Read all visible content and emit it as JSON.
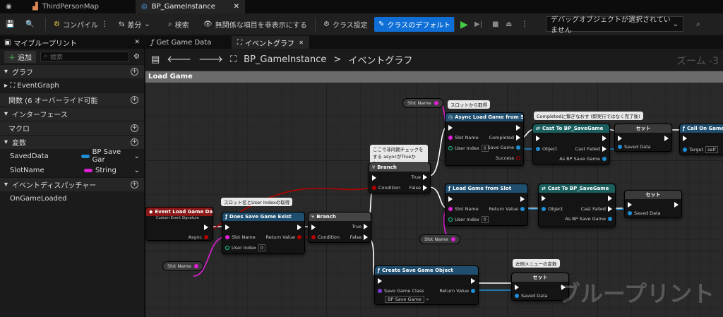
{
  "tabs": {
    "items": [
      {
        "label": "ThirdPersonMap"
      },
      {
        "label": "BP_GameInstance"
      }
    ]
  },
  "toolbar": {
    "compile": "コンパイル",
    "diff": "差分",
    "search": "検索",
    "hide": "無関係な項目を非表示にする",
    "class_settings": "クラス設定",
    "class_defaults": "クラスのデフォルト",
    "debug": "デバッグオブジェクトが選択されていません"
  },
  "left": {
    "title": "マイブループリント",
    "add": "追加",
    "search_placeholder": "検索",
    "graph": "グラフ",
    "eventgraph": "EventGraph",
    "functions": "関数 (6 オーバーライド可能",
    "interfaces": "インターフェース",
    "macros": "マクロ",
    "variables": "変数",
    "vars": [
      {
        "name": "SavedData",
        "type": "BP Save Gar",
        "color": "#1e8fd6"
      },
      {
        "name": "SlotName",
        "type": "String",
        "color": "#e01fd6"
      }
    ],
    "dispatchers": "イベントディスパッチャー",
    "dispatcher_item": "OnGameLoaded"
  },
  "graph": {
    "tab1": "Get Game Data",
    "tab2": "イベントグラフ",
    "crumb1": "BP_GameInstance",
    "crumb_sep": ">",
    "crumb2": "イベントグラフ",
    "zoom": "ズーム -3",
    "comment": "Load Game",
    "watermark": "ブループリント",
    "nodes": {
      "event": {
        "title": "Event Load Game Data",
        "sub": "Custom Event Signature",
        "async": "Async"
      },
      "exists": {
        "title": "Does Save Game Exist",
        "slot": "Slot Name",
        "ret": "Return Value",
        "user": "User Index",
        "user_val": "0"
      },
      "branch1": {
        "title": "Branch",
        "cond": "Condition",
        "t": "True",
        "f": "False"
      },
      "branch2": {
        "title": "Branch",
        "cond": "Condition",
        "t": "True",
        "f": "False"
      },
      "async_load": {
        "title": "Async Load Game from Slot",
        "slot": "Slot Name",
        "user": "User Index",
        "user_val": "0",
        "completed": "Completed",
        "save": "Save Game",
        "success": "Success"
      },
      "cast1": {
        "title": "Cast To BP_SaveGame",
        "obj": "Object",
        "failed": "Cast Failed",
        "as": "As BP Save Game"
      },
      "set1": {
        "title": "セット",
        "saved": "Saved Data"
      },
      "call": {
        "title": "Call On Game Lo",
        "target": "Target",
        "self": "self"
      },
      "load": {
        "title": "Load Game from Slot",
        "slot": "Slot Name",
        "ret": "Return Value",
        "user": "User Index",
        "user_val": "0"
      },
      "cast2": {
        "title": "Cast To BP_SaveGame",
        "obj": "Object",
        "failed": "Cast Failed",
        "as": "As BP Save Game"
      },
      "set2": {
        "title": "セット",
        "saved": "Saved Data"
      },
      "create": {
        "title": "Create Save Game Object",
        "cls": "Save Game Class",
        "cls_val": "BP Save Game",
        "ret": "Return Value"
      },
      "set3": {
        "title": "セット",
        "saved": "Saved Data"
      }
    },
    "vars": {
      "slot1": "Slot Name",
      "slot2": "Slot Name",
      "slot3": "Slot Name"
    },
    "bubbles": {
      "b1": "スロット名とUser Indexの取得",
      "b2": "ここで非同期チェックをする asyncがTrueかFalseか",
      "b3": "スロットから取得",
      "b4": "Completedに繋ぎなおす (即実行ではなく完了後)",
      "b5": "左側メニューの変数"
    }
  }
}
